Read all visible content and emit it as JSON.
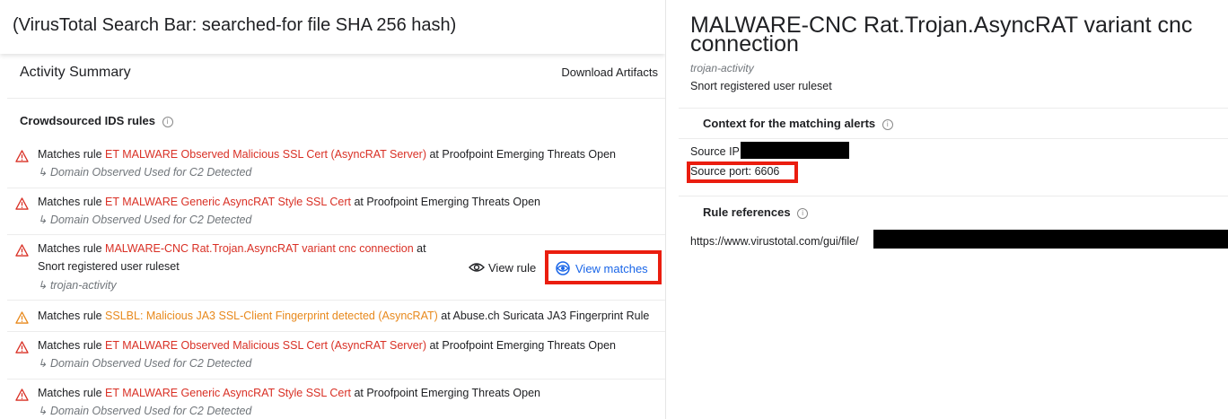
{
  "search_bar": {
    "text": "(VirusTotal Search Bar: searched-for file SHA 256 hash)"
  },
  "activity": {
    "title": "Activity Summary",
    "download_label": "Download Artifacts"
  },
  "ids": {
    "title": "Crowdsourced IDS rules",
    "rules": [
      {
        "prefix": "Matches rule ",
        "name": "ET MALWARE Observed Malicious SSL Cert (AsyncRAT Server)",
        "suffix": " at Proofpoint Emerging Threats Open",
        "sub": "Domain Observed Used for C2 Detected",
        "color": "#d93025"
      },
      {
        "prefix": "Matches rule ",
        "name": "ET MALWARE Generic AsyncRAT Style SSL Cert",
        "suffix": " at Proofpoint Emerging Threats Open",
        "sub": "Domain Observed Used for C2 Detected",
        "color": "#d93025"
      },
      {
        "prefix": "Matches rule ",
        "name": "MALWARE-CNC Rat.Trojan.AsyncRAT variant cnc connection",
        "suffix": " at",
        "line2": "Snort registered user ruleset",
        "sub": "trojan-activity",
        "view_rule": "View rule",
        "view_matches": "View matches",
        "color": "#d93025"
      },
      {
        "prefix": "Matches rule ",
        "name": "SSLBL: Malicious JA3 SSL-Client Fingerprint detected (AsyncRAT)",
        "suffix": " at Abuse.ch Suricata JA3 Fingerprint Rule",
        "color": "#e8891c"
      },
      {
        "prefix": "Matches rule ",
        "name": "ET MALWARE Observed Malicious SSL Cert (AsyncRAT Server)",
        "suffix": " at Proofpoint Emerging Threats Open",
        "sub": "Domain Observed Used for C2 Detected",
        "color": "#d93025"
      },
      {
        "prefix": "Matches rule ",
        "name": "ET MALWARE Generic AsyncRAT Style SSL Cert",
        "suffix": " at Proofpoint Emerging Threats Open",
        "sub": "Domain Observed Used for C2 Detected",
        "color": "#d93025"
      }
    ]
  },
  "detail": {
    "title": "MALWARE-CNC Rat.Trojan.AsyncRAT variant cnc connection",
    "category": "trojan-activity",
    "ruleset": "Snort registered user ruleset",
    "context_title": "Context for the matching alerts",
    "source_ip_label": "Source IP:",
    "source_port_label": "Source port: 6606",
    "references_title": "Rule references",
    "reference_url": "https://www.virustotal.com/gui/file/"
  },
  "colors": {
    "highlight_box": "#ea1d0f",
    "rule_red": "#d93025",
    "rule_orange": "#e8891c",
    "link_blue": "#1a66e8"
  },
  "icons": [
    "warning-triangle-icon",
    "info-icon",
    "eye-icon",
    "target-icon",
    "subdirectory-arrow-icon"
  ]
}
